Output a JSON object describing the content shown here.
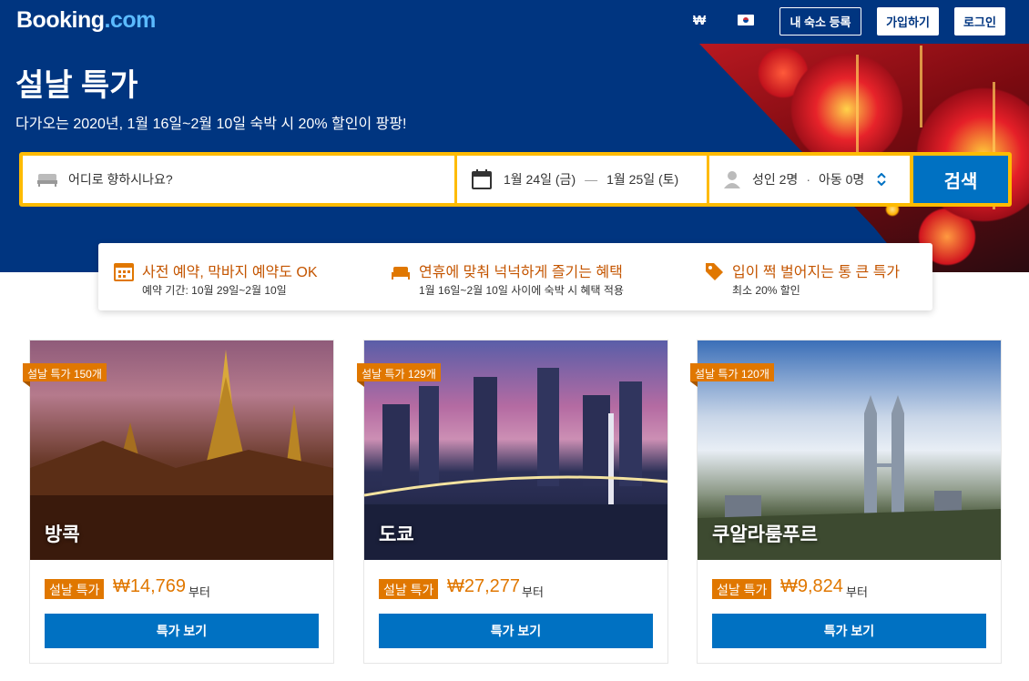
{
  "header": {
    "logo_main": "Booking",
    "logo_tld": ".com",
    "currency": "₩",
    "list_property": "내 숙소 등록",
    "register": "가입하기",
    "login": "로그인"
  },
  "hero": {
    "title": "설날 특가",
    "subtitle": "다가오는 2020년, 1월 16일~2월 10일 숙박 시 20% 할인이 팡팡!"
  },
  "search": {
    "destination_placeholder": "어디로 향하시나요?",
    "checkin": "1월 24일 (금)",
    "separator": "—",
    "checkout": "1월 25일 (토)",
    "adults": "성인 2명",
    "dot": "·",
    "children": "아동 0명",
    "button": "검색"
  },
  "features": [
    {
      "icon": "calendar-icon",
      "title": "사전 예약, 막바지 예약도 OK",
      "desc": "예약 기간: 10월 29일~2월 10일"
    },
    {
      "icon": "bed-icon",
      "title": "연휴에 맞춰 넉넉하게 즐기는 혜택",
      "desc": "1월 16일~2월 10일 사이에 숙박 시 혜택 적용"
    },
    {
      "icon": "price-tag-icon",
      "title": "입이 쩍 벌어지는 통 큰 특가",
      "desc": "최소 20% 할인"
    }
  ],
  "cards": [
    {
      "ribbon": "설날 특가 150개",
      "city": "방콕",
      "tag": "설날 특가",
      "price": "₩14,769",
      "from": "부터",
      "cta": "특가 보기"
    },
    {
      "ribbon": "설날 특가 129개",
      "city": "도쿄",
      "tag": "설날 특가",
      "price": "₩27,277",
      "from": "부터",
      "cta": "특가 보기"
    },
    {
      "ribbon": "설날 특가 120개",
      "city": "쿠알라룸푸르",
      "tag": "설날 특가",
      "price": "₩9,824",
      "from": "부터",
      "cta": "특가 보기"
    }
  ],
  "colors": {
    "brand_blue": "#003580",
    "button_blue": "#0071c2",
    "search_border": "#febb02",
    "deal_orange": "#e07700",
    "feature_orange": "#c45500"
  }
}
